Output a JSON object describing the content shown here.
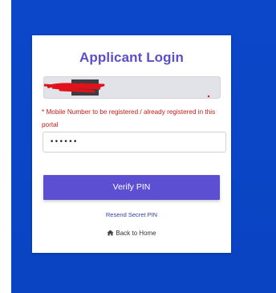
{
  "login": {
    "title": "Applicant Login",
    "mobile_hint": "* Mobile Number to be registered / already registered in this portal",
    "pin_value": "••••••",
    "verify_button": "Verify PIN",
    "resend_link": "Resend Secret PIN",
    "back_link": "Back to Home"
  },
  "icons": {
    "home": "home-icon"
  },
  "colors": {
    "background": "#0a45c8",
    "title": "#5b4fc9",
    "button": "#5c4fd2",
    "hint": "#c81a1a"
  }
}
